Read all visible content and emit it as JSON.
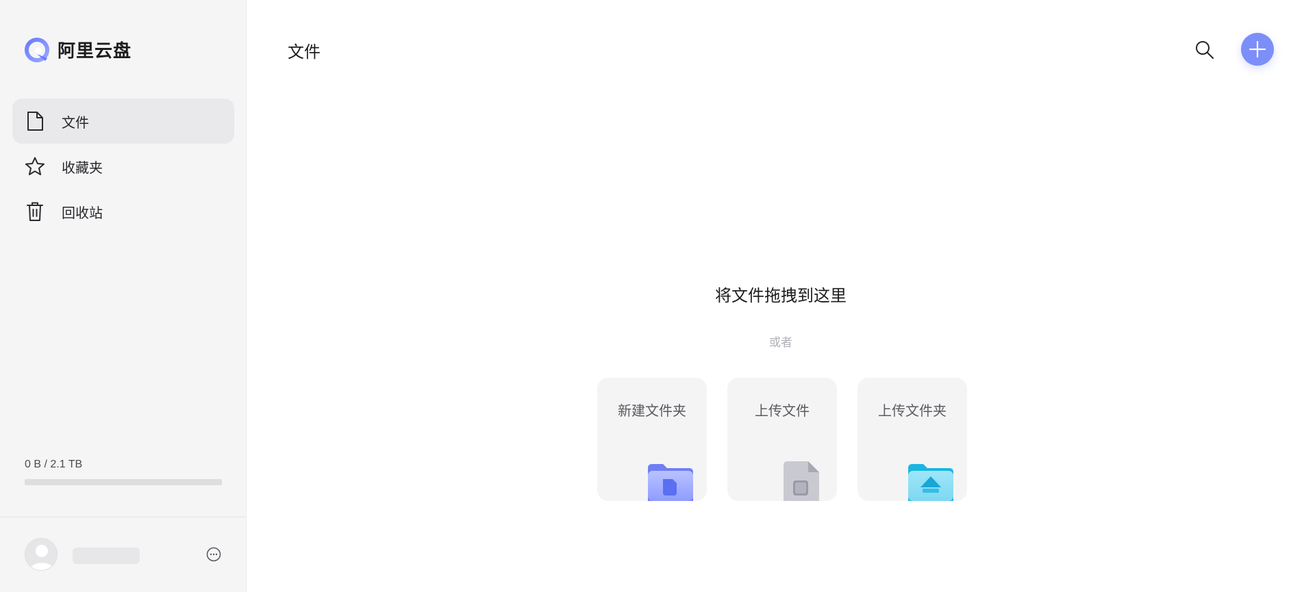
{
  "app": {
    "name": "阿里云盘"
  },
  "sidebar": {
    "items": [
      {
        "label": "文件",
        "icon": "file-icon",
        "active": true
      },
      {
        "label": "收藏夹",
        "icon": "star-icon",
        "active": false
      },
      {
        "label": "回收站",
        "icon": "trash-icon",
        "active": false
      }
    ],
    "storage": {
      "text": "0 B / 2.1 TB",
      "used_fraction": 0
    }
  },
  "header": {
    "title": "文件"
  },
  "main": {
    "drop_text": "将文件拖拽到这里",
    "or_text": "或者",
    "actions": [
      {
        "label": "新建文件夹",
        "icon": "new-folder-icon"
      },
      {
        "label": "上传文件",
        "icon": "upload-file-icon"
      },
      {
        "label": "上传文件夹",
        "icon": "upload-folder-icon"
      }
    ]
  },
  "colors": {
    "accent": "#637dff",
    "sidebar_bg": "#f5f5f6"
  }
}
